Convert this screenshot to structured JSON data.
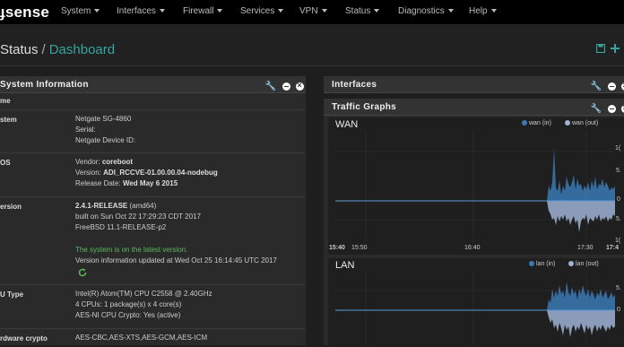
{
  "nav": {
    "brand": "sense",
    "items": [
      "System",
      "Interfaces",
      "Firewall",
      "Services",
      "VPN",
      "Status",
      "Diagnostics",
      "Help"
    ]
  },
  "breadcrumb": {
    "parent": "Status",
    "separator": "/",
    "current": "Dashboard"
  },
  "sysinfo": {
    "title": "System Information",
    "name_label": "me",
    "rows": [
      {
        "label": "stem",
        "lines": [
          "Netgate SG-4860",
          "Serial:",
          "Netgate Device ID:"
        ]
      },
      {
        "label": "OS",
        "vendor_label": "Vendor:",
        "vendor": "coreboot",
        "version_label": "Version:",
        "version": "ADI_RCCVE-01.00.00.04-nodebug",
        "release_label": "Release Date:",
        "release": "Wed May 6 2015"
      },
      {
        "label": "ersion",
        "ver": "2.4.1-RELEASE",
        "arch": "(amd64)",
        "built": "built on Sun Oct 22 17:29:23 CDT 2017",
        "freebsd": "FreeBSD 11.1-RELEASE-p2",
        "latest": "The system is on the latest version.",
        "updated": "Version information updated at Wed Oct 25 16:14:45 UTC 2017"
      },
      {
        "label": "U Type",
        "lines": [
          "Intel(R) Atom(TM) CPU C2558 @ 2.40GHz",
          "4 CPUs: 1 package(s) x 4 core(s)",
          "AES-NI CPU Crypto: Yes (active)"
        ]
      },
      {
        "label": "rdware crypto",
        "lines": [
          "AES-CBC,AES-XTS,AES-GCM,AES-ICM"
        ]
      }
    ]
  },
  "interfaces": {
    "title": "Interfaces"
  },
  "traffic": {
    "title": "Traffic Graphs",
    "wan": {
      "title": "WAN",
      "legend_in": "wan (in)",
      "legend_out": "wan (out)",
      "xticks": [
        "15:40",
        "15:50",
        "16:40",
        "17:30",
        "17:4"
      ],
      "yticks": [
        "1(",
        "5.",
        "0",
        "5.",
        "1("
      ]
    },
    "lan": {
      "title": "LAN",
      "legend_in": "lan (in)",
      "legend_out": "lan (out)",
      "yticks": [
        "5.",
        "0"
      ]
    }
  },
  "colors": {
    "accent": "#35a5a0",
    "in": "#3b79b4",
    "out": "#9fb3d6",
    "ok": "#5cb85c"
  },
  "chart_data": [
    {
      "type": "area",
      "title": "WAN",
      "series": [
        {
          "name": "wan (in)"
        },
        {
          "name": "wan (out)"
        }
      ]
    },
    {
      "type": "area",
      "title": "LAN",
      "series": [
        {
          "name": "lan (in)"
        },
        {
          "name": "lan (out)"
        }
      ]
    }
  ]
}
